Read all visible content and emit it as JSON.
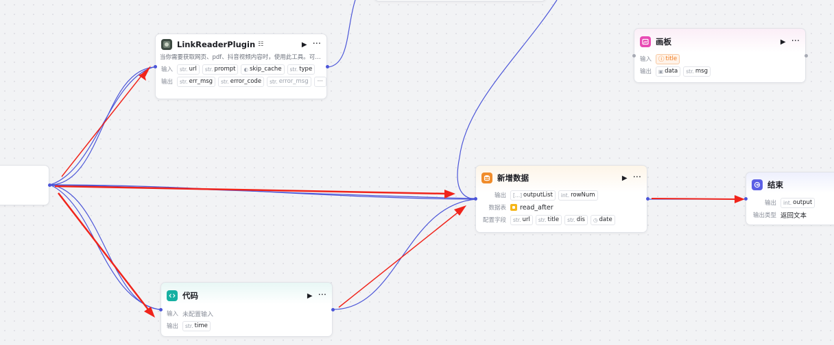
{
  "nodes": {
    "link_reader": {
      "title": "LinkReaderPlugin",
      "description": "当你需要获取网页、pdf、抖音视频内容时，使用此工具。可…",
      "input_label": "输入",
      "output_label": "输出",
      "inputs": [
        {
          "type": "str",
          "name": "url"
        },
        {
          "type": "str",
          "name": "prompt"
        },
        {
          "type": "bool",
          "name": "skip_cache"
        },
        {
          "type": "str",
          "name": "type"
        }
      ],
      "outputs": [
        {
          "type": "str",
          "name": "err_msg"
        },
        {
          "type": "str",
          "name": "error_code"
        },
        {
          "type": "str",
          "name": "error_msg"
        }
      ],
      "more": "···"
    },
    "canvas": {
      "title": "画板",
      "input_label": "输入",
      "output_label": "输出",
      "input_chip": "title",
      "outputs": [
        {
          "type": "img",
          "name": "data"
        },
        {
          "type": "str",
          "name": "msg"
        }
      ]
    },
    "add_data": {
      "title": "新增数据",
      "output_label": "输出",
      "table_label": "数据表",
      "fields_label": "配置字段",
      "outputs": [
        {
          "type": "[...]",
          "name": "outputList"
        },
        {
          "type": "int",
          "name": "rowNum"
        }
      ],
      "table_name": "read_after",
      "fields": [
        {
          "type": "str",
          "name": "url"
        },
        {
          "type": "str",
          "name": "title"
        },
        {
          "type": "str",
          "name": "dis"
        },
        {
          "type": "time",
          "name": "date"
        }
      ]
    },
    "end": {
      "title": "结束",
      "output_label": "输出",
      "output_type_label": "输出类型",
      "output": {
        "type": "int",
        "name": "output"
      },
      "output_type_value": "返回文本"
    },
    "code": {
      "title": "代码",
      "input_label": "输入",
      "output_label": "输出",
      "input_value": "未配置输入",
      "output": {
        "type": "str",
        "name": "time"
      }
    }
  },
  "colors": {
    "edge": "#4b55d8",
    "annotation_arrow": "#f0241b",
    "background": "#f2f3f5"
  }
}
